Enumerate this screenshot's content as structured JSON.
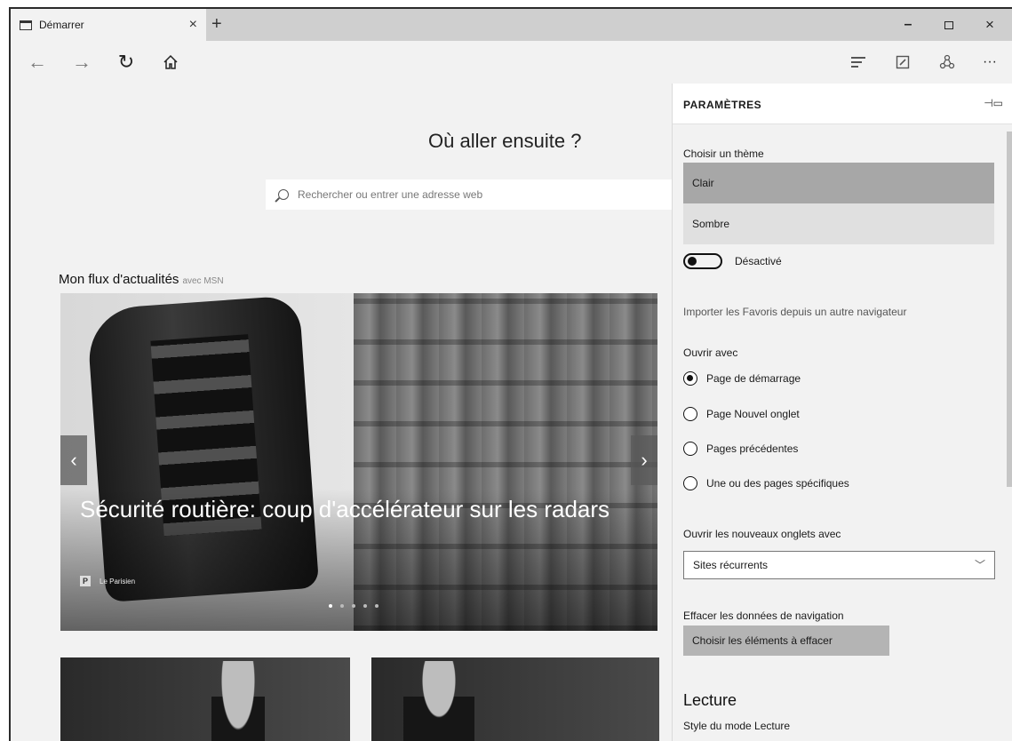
{
  "tab": {
    "title": "Démarrer"
  },
  "newtab_label": "+",
  "window": {
    "minimize": "–",
    "close": "×"
  },
  "nav": {
    "back": "←",
    "forward": "→",
    "refresh": "↻",
    "more": "···"
  },
  "content": {
    "heading": "Où aller ensuite ?",
    "search_placeholder": "Rechercher ou entrer une adresse web",
    "feed_title": "Mon flux d'actualités",
    "feed_source": "avec MSN",
    "hero_headline": "Sécurité routière: coup d'accélérateur sur les radars",
    "hero_source_logo": "P",
    "hero_source": "Le Parisien",
    "prev": "‹",
    "next": "›",
    "carousel_count": 5,
    "carousel_active_index": 0
  },
  "settings": {
    "title": "PARAMÈTRES",
    "pin_icon_name": "pin-icon",
    "theme_label": "Choisir un thème",
    "theme_options": [
      "Clair",
      "Sombre"
    ],
    "theme_selected": "Clair",
    "toggle_state": "Désactivé",
    "import_link": "Importer les Favoris depuis un autre navigateur",
    "open_with_label": "Ouvrir avec",
    "open_with_options": [
      "Page de démarrage",
      "Page Nouvel onglet",
      "Pages précédentes",
      "Une ou des pages spécifiques"
    ],
    "open_with_selected": "Page de démarrage",
    "new_tabs_label": "Ouvrir les nouveaux onglets avec",
    "new_tabs_value": "Sites récurrents",
    "clear_label": "Effacer les données de navigation",
    "clear_button": "Choisir les éléments à effacer",
    "reading_section": "Lecture",
    "reading_style_label": "Style du mode Lecture"
  }
}
